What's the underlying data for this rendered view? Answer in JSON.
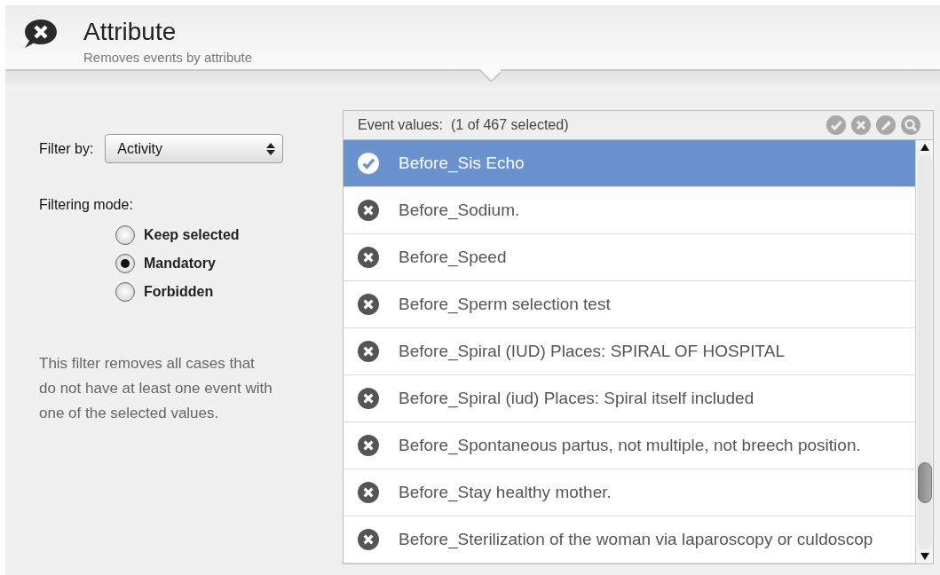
{
  "header": {
    "title": "Attribute",
    "subtitle": "Removes events by attribute"
  },
  "filter_by": {
    "label": "Filter by:",
    "value": "Activity"
  },
  "filtering_mode": {
    "label": "Filtering mode:",
    "options": [
      {
        "label": "Keep selected",
        "selected": false
      },
      {
        "label": "Mandatory",
        "selected": true
      },
      {
        "label": "Forbidden",
        "selected": false
      }
    ]
  },
  "description": "This filter removes all cases that do not have at least one event with one of the selected values.",
  "event_values": {
    "label": "Event values:",
    "count": "(1 of 467 selected)",
    "items": [
      {
        "label": "Before_Sis Echo",
        "selected": true
      },
      {
        "label": "Before_Sodium.",
        "selected": false
      },
      {
        "label": "Before_Speed",
        "selected": false
      },
      {
        "label": "Before_Sperm selection test",
        "selected": false
      },
      {
        "label": "Before_Spiral (IUD) Places: SPIRAL OF HOSPITAL",
        "selected": false
      },
      {
        "label": "Before_Spiral (iud) Places: Spiral itself included",
        "selected": false
      },
      {
        "label": "Before_Spontaneous partus, not multiple, not breech position.",
        "selected": false
      },
      {
        "label": "Before_Stay healthy mother.",
        "selected": false
      },
      {
        "label": "Before_Sterilization of the woman via laparoscopy or culdoscop",
        "selected": false
      }
    ]
  }
}
